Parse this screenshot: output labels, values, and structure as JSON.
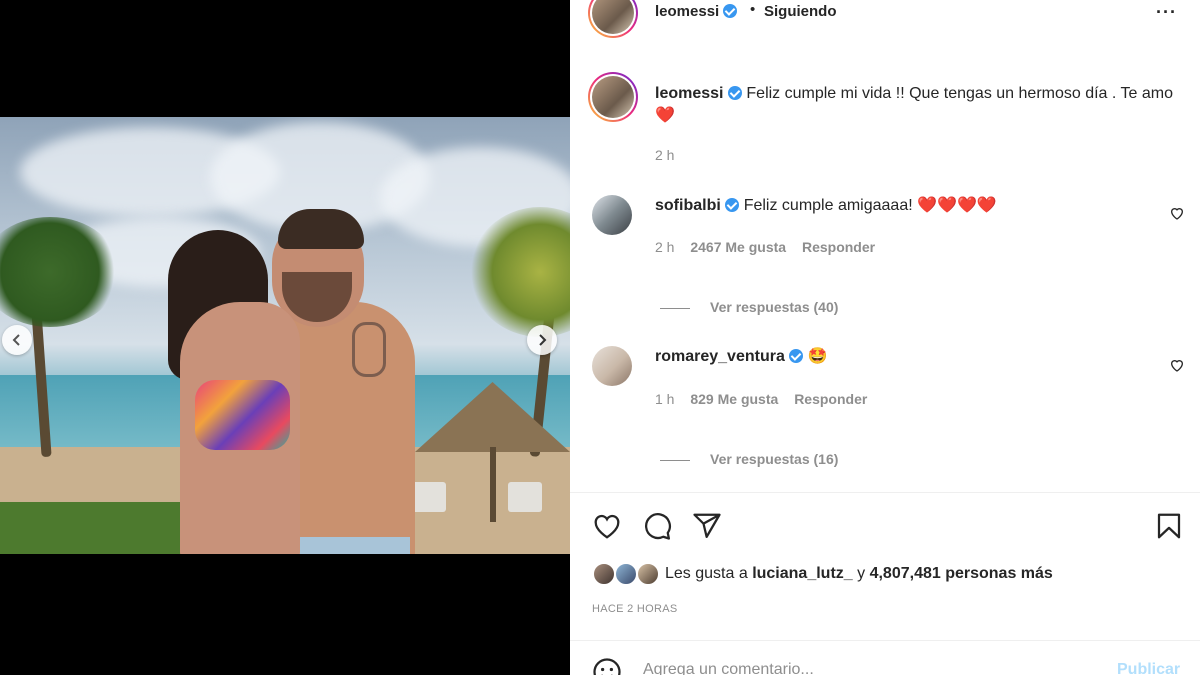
{
  "post": {
    "author": "leomessi",
    "follow_state": "Siguiendo",
    "dot": "•",
    "more": "···",
    "caption_text": "Feliz cumple mi vida !! Que tengas un hermoso día . Te amo",
    "caption_heart": "❤️",
    "caption_time": "2 h"
  },
  "comments": [
    {
      "user": "sofibalbi",
      "verified": true,
      "text": "Feliz cumple amigaaaa!",
      "emojis": "❤️❤️❤️❤️",
      "time": "2 h",
      "likes": "2467 Me gusta",
      "reply": "Responder",
      "view_replies": "Ver respuestas (40)"
    },
    {
      "user": "romarey_ventura",
      "verified": true,
      "text": "",
      "emojis": "🤩",
      "time": "1 h",
      "likes": "829 Me gusta",
      "reply": "Responder",
      "view_replies": "Ver respuestas (16)"
    }
  ],
  "likes": {
    "prefix": "Les gusta a",
    "user": "luciana_lutz_",
    "middle": "y",
    "count": "4,807,481 personas más"
  },
  "time_ago": "HACE 2 HORAS",
  "comment_box": {
    "placeholder": "Agrega un comentario...",
    "publish": "Publicar"
  },
  "icons": {
    "like": "heart-icon",
    "comment": "comment-icon",
    "share": "share-icon",
    "save": "bookmark-icon",
    "emoji": "emoji-icon"
  },
  "colors": {
    "verified": "#3897f0",
    "publish_disabled": "#b2dffc",
    "secondary_text": "#8e8e8e"
  }
}
